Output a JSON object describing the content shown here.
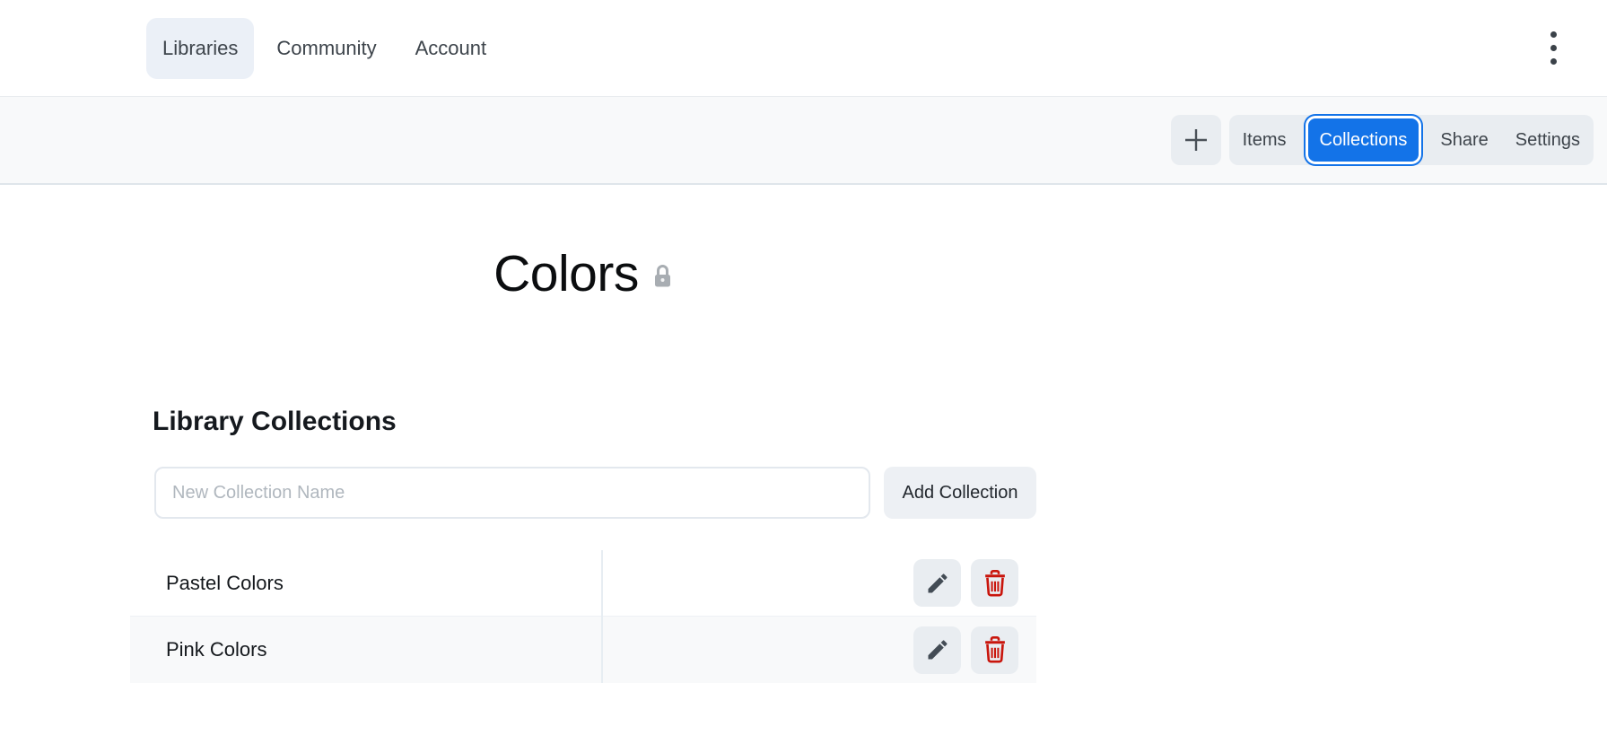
{
  "nav": {
    "items": [
      {
        "label": "Libraries",
        "active": true
      },
      {
        "label": "Community",
        "active": false
      },
      {
        "label": "Account",
        "active": false
      }
    ],
    "menu_icon": "kebab-vertical-icon"
  },
  "toolbar": {
    "add_icon": "plus-icon",
    "segments": [
      {
        "label": "Items",
        "active": false
      },
      {
        "label": "Collections",
        "active": true
      },
      {
        "label": "Share",
        "active": false
      },
      {
        "label": "Settings",
        "active": false
      }
    ]
  },
  "page": {
    "title": "Colors",
    "privacy_icon": "lock-icon"
  },
  "collections": {
    "heading": "Library Collections",
    "input_value": "",
    "input_placeholder": "New Collection Name",
    "add_button_label": "Add Collection",
    "rows": [
      {
        "name": "Pastel Colors"
      },
      {
        "name": "Pink Colors"
      }
    ]
  },
  "colors": {
    "accent_blue": "#1373e8",
    "danger_red": "#c9150c",
    "toolbar_bg": "#f8f9fa",
    "button_gray": "#e9edf1",
    "active_tab_bg": "#ebf0f7"
  }
}
